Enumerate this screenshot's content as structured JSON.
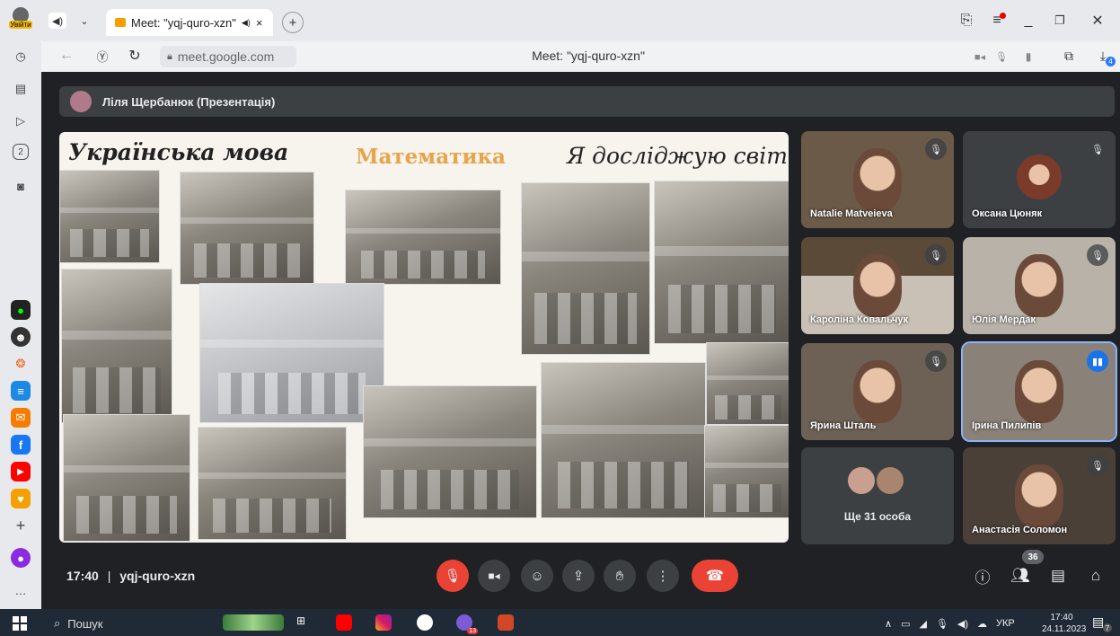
{
  "browser": {
    "profile_label": "Увійти",
    "tab_title": "Meet: \"yqj-quro-xzn\"",
    "url": "meet.google.com",
    "page_title": "Meet: \"yqj-quro-xzn\"",
    "download_badge": "4"
  },
  "presenter_bar": {
    "label": "Ліля Щербанюк (Презентація)"
  },
  "slide": {
    "heading_left": "Українська мова",
    "heading_center": "Математика",
    "heading_right": "Я досліджую світ",
    "heading_center_color": "#e8a44a"
  },
  "participants": [
    {
      "name": "Natalie Matveieva",
      "muted": true
    },
    {
      "name": "Оксана Цюняк",
      "muted": true
    },
    {
      "name": "Кароліна Ковальчук",
      "muted": true
    },
    {
      "name": "Юлія Мердак",
      "muted": true
    },
    {
      "name": "Ярина Шталь",
      "muted": true
    },
    {
      "name": "Ірина Пилипів",
      "muted": false,
      "speaking": true
    },
    {
      "name": "Анастасія Соломон",
      "muted": true
    }
  ],
  "others_tile": {
    "label": "Ще 31 особа"
  },
  "meeting": {
    "time": "17:40",
    "separator": "|",
    "code": "yqj-quro-xzn",
    "people_count": "36"
  },
  "taskbar": {
    "search_label": "Пошук",
    "language": "УКР",
    "time": "17:40",
    "date": "24.11.2023",
    "notification_count": "7",
    "yandex_badge": "13"
  },
  "colors": {
    "accent": "#8ab4f8",
    "danger": "#ea4335",
    "meet_bg": "#202124"
  }
}
